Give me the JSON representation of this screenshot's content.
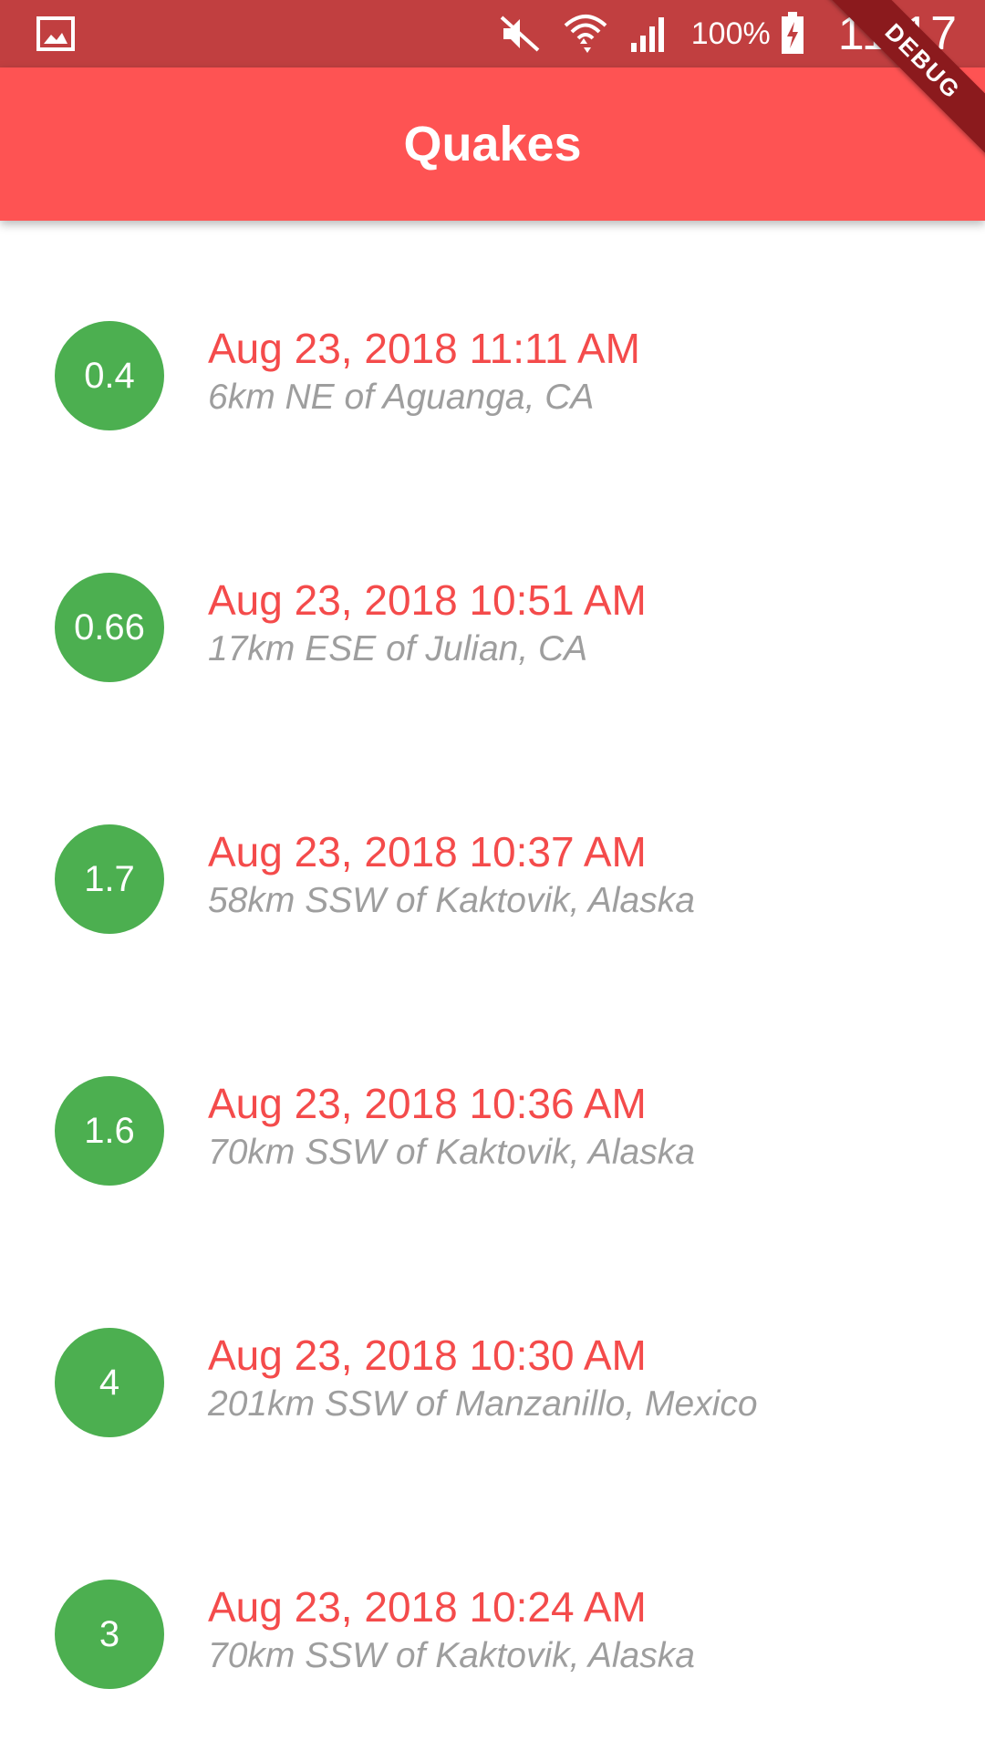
{
  "status_bar": {
    "battery_percent": "100%",
    "time": "11:17",
    "icons": [
      "image-icon",
      "mute-icon",
      "wifi-icon",
      "signal-icon",
      "battery-icon"
    ]
  },
  "app_bar": {
    "title": "Quakes"
  },
  "debug_banner": "DEBUG",
  "colors": {
    "status_bar": "#c13f40",
    "app_bar": "#fe5353",
    "date_text": "#f44b4b",
    "place_text": "#9e9e9e",
    "magnitude_badge": "#4caf50"
  },
  "quakes": [
    {
      "magnitude": "0.4",
      "date": "Aug 23, 2018 11:11 AM",
      "place": "6km NE of Aguanga, CA"
    },
    {
      "magnitude": "0.66",
      "date": "Aug 23, 2018 10:51 AM",
      "place": "17km ESE of Julian, CA"
    },
    {
      "magnitude": "1.7",
      "date": "Aug 23, 2018 10:37 AM",
      "place": "58km SSW of Kaktovik, Alaska"
    },
    {
      "magnitude": "1.6",
      "date": "Aug 23, 2018 10:36 AM",
      "place": "70km SSW of Kaktovik, Alaska"
    },
    {
      "magnitude": "4",
      "date": "Aug 23, 2018 10:30 AM",
      "place": "201km SSW of Manzanillo, Mexico"
    },
    {
      "magnitude": "3",
      "date": "Aug 23, 2018 10:24 AM",
      "place": "70km SSW of Kaktovik, Alaska"
    }
  ]
}
